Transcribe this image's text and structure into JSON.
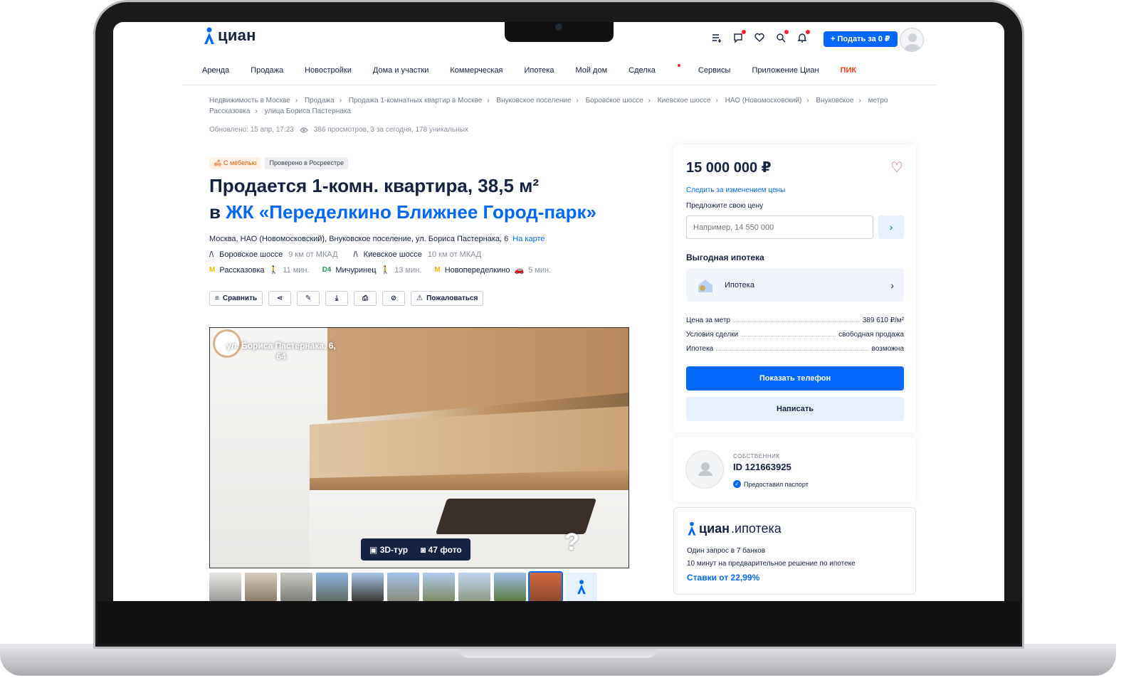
{
  "header": {
    "logo": "циан",
    "post_button": "+ Подать за 0 ₽"
  },
  "nav": [
    "Аренда",
    "Продажа",
    "Новостройки",
    "Дома и участки",
    "Коммерческая",
    "Ипотека",
    "Мой дом",
    "Сделка",
    "Сервисы",
    "Приложение Циан",
    "ПИК"
  ],
  "breadcrumbs": [
    "Недвижимость в Москве",
    "Продажа",
    "Продажа 1-комнатных квартир в Москве",
    "Внуковское поселение",
    "Боровское шоссе",
    "Киевское шоссе",
    "НАО (Новомосковский)",
    "Внуковское",
    "метро Рассказовка",
    "улица Бориса Пастернака"
  ],
  "updated": "Обновлено: 15 апр, 17:23",
  "views": "386 просмотров, 3 за сегодня, 178 уникальных",
  "badges": {
    "furniture": "С мебелью",
    "rosreestr": "Проверено в Росреестре"
  },
  "title": {
    "line1": "Продается 1-комн. квартира, 38,5 м²",
    "prefix": "в",
    "zhk": "ЖК «Переделкино Ближнее Город-парк»"
  },
  "address": {
    "text": "Москва, НАО (Новомосковский), Внуковское поселение, ул. Бориса Пастернака, 6",
    "map_link": "На карте"
  },
  "roads": [
    {
      "name": "Боровское шоссе",
      "dist": "9 км от МКАД"
    },
    {
      "name": "Киевское шоссе",
      "dist": "10 км от МКАД"
    }
  ],
  "metros": [
    {
      "line": "М",
      "name": "Рассказовка",
      "time": "11 мин."
    },
    {
      "line": "D4",
      "name": "Мичуринец",
      "time": "13 мин."
    },
    {
      "line": "М",
      "name": "Новопеределкино",
      "time": "5 мин."
    }
  ],
  "actions": {
    "compare": "Сравнить",
    "complain": "Пожаловаться"
  },
  "photo": {
    "overlay": "ул. Бориса Пастернака, 6, 64",
    "tour": "3D-тур",
    "photos": "47 фото",
    "qmark": "?"
  },
  "price_card": {
    "price": "15 000 000 ₽",
    "follow": "Следить за изменением цены",
    "offer_label": "Предложите свою цену",
    "offer_placeholder": "Например, 14 550 000",
    "mortgage_title": "Выгодная ипотека",
    "mortgage_item": "Ипотека",
    "facts": [
      {
        "label": "Цена за метр",
        "value": "389 610 ₽/м²"
      },
      {
        "label": "Условия сделки",
        "value": "свободная продажа"
      },
      {
        "label": "Ипотека",
        "value": "возможна"
      }
    ],
    "phone_button": "Показать телефон",
    "message_button": "Написать"
  },
  "owner": {
    "role": "СОБСТВЕННИК",
    "id": "ID 121663925",
    "passport": "Предоставил паспорт"
  },
  "ipoteka": {
    "logo_brand": "циан",
    "logo_suffix": ".ипотека",
    "line1": "Один запрос в 7 банков",
    "line2": "10 минут на предварительное решение по ипотеке",
    "line3": "Ставки от 22,99%"
  },
  "colors": {
    "accent": "#0468ff",
    "text": "#152242",
    "pik": "#ff3d17",
    "heart": "#e62e4a"
  }
}
